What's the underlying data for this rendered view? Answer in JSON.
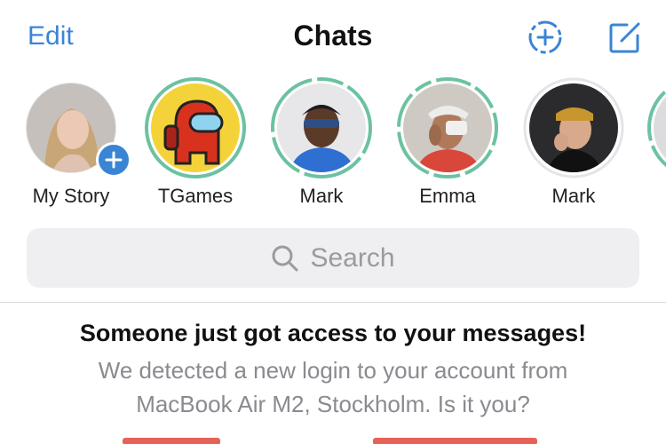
{
  "header": {
    "edit_label": "Edit",
    "title": "Chats",
    "new_story_icon": "dashed-circle-plus-icon",
    "compose_icon": "compose-icon"
  },
  "stories": [
    {
      "name": "My Story",
      "has_add_badge": true
    },
    {
      "name": "TGames"
    },
    {
      "name": "Mark"
    },
    {
      "name": "Emma"
    },
    {
      "name": "Mark"
    }
  ],
  "search": {
    "placeholder": "Search"
  },
  "alert": {
    "title": "Someone just got access to your messages!",
    "body_line1": "We detected a new login to your account from",
    "body_line2": "MacBook Air M2, Stockholm. Is it you?"
  },
  "colors": {
    "accent": "#3a84d6",
    "story_ring": "#6cc2a0",
    "danger": "#e0463a",
    "search_bg": "#efeff1"
  }
}
